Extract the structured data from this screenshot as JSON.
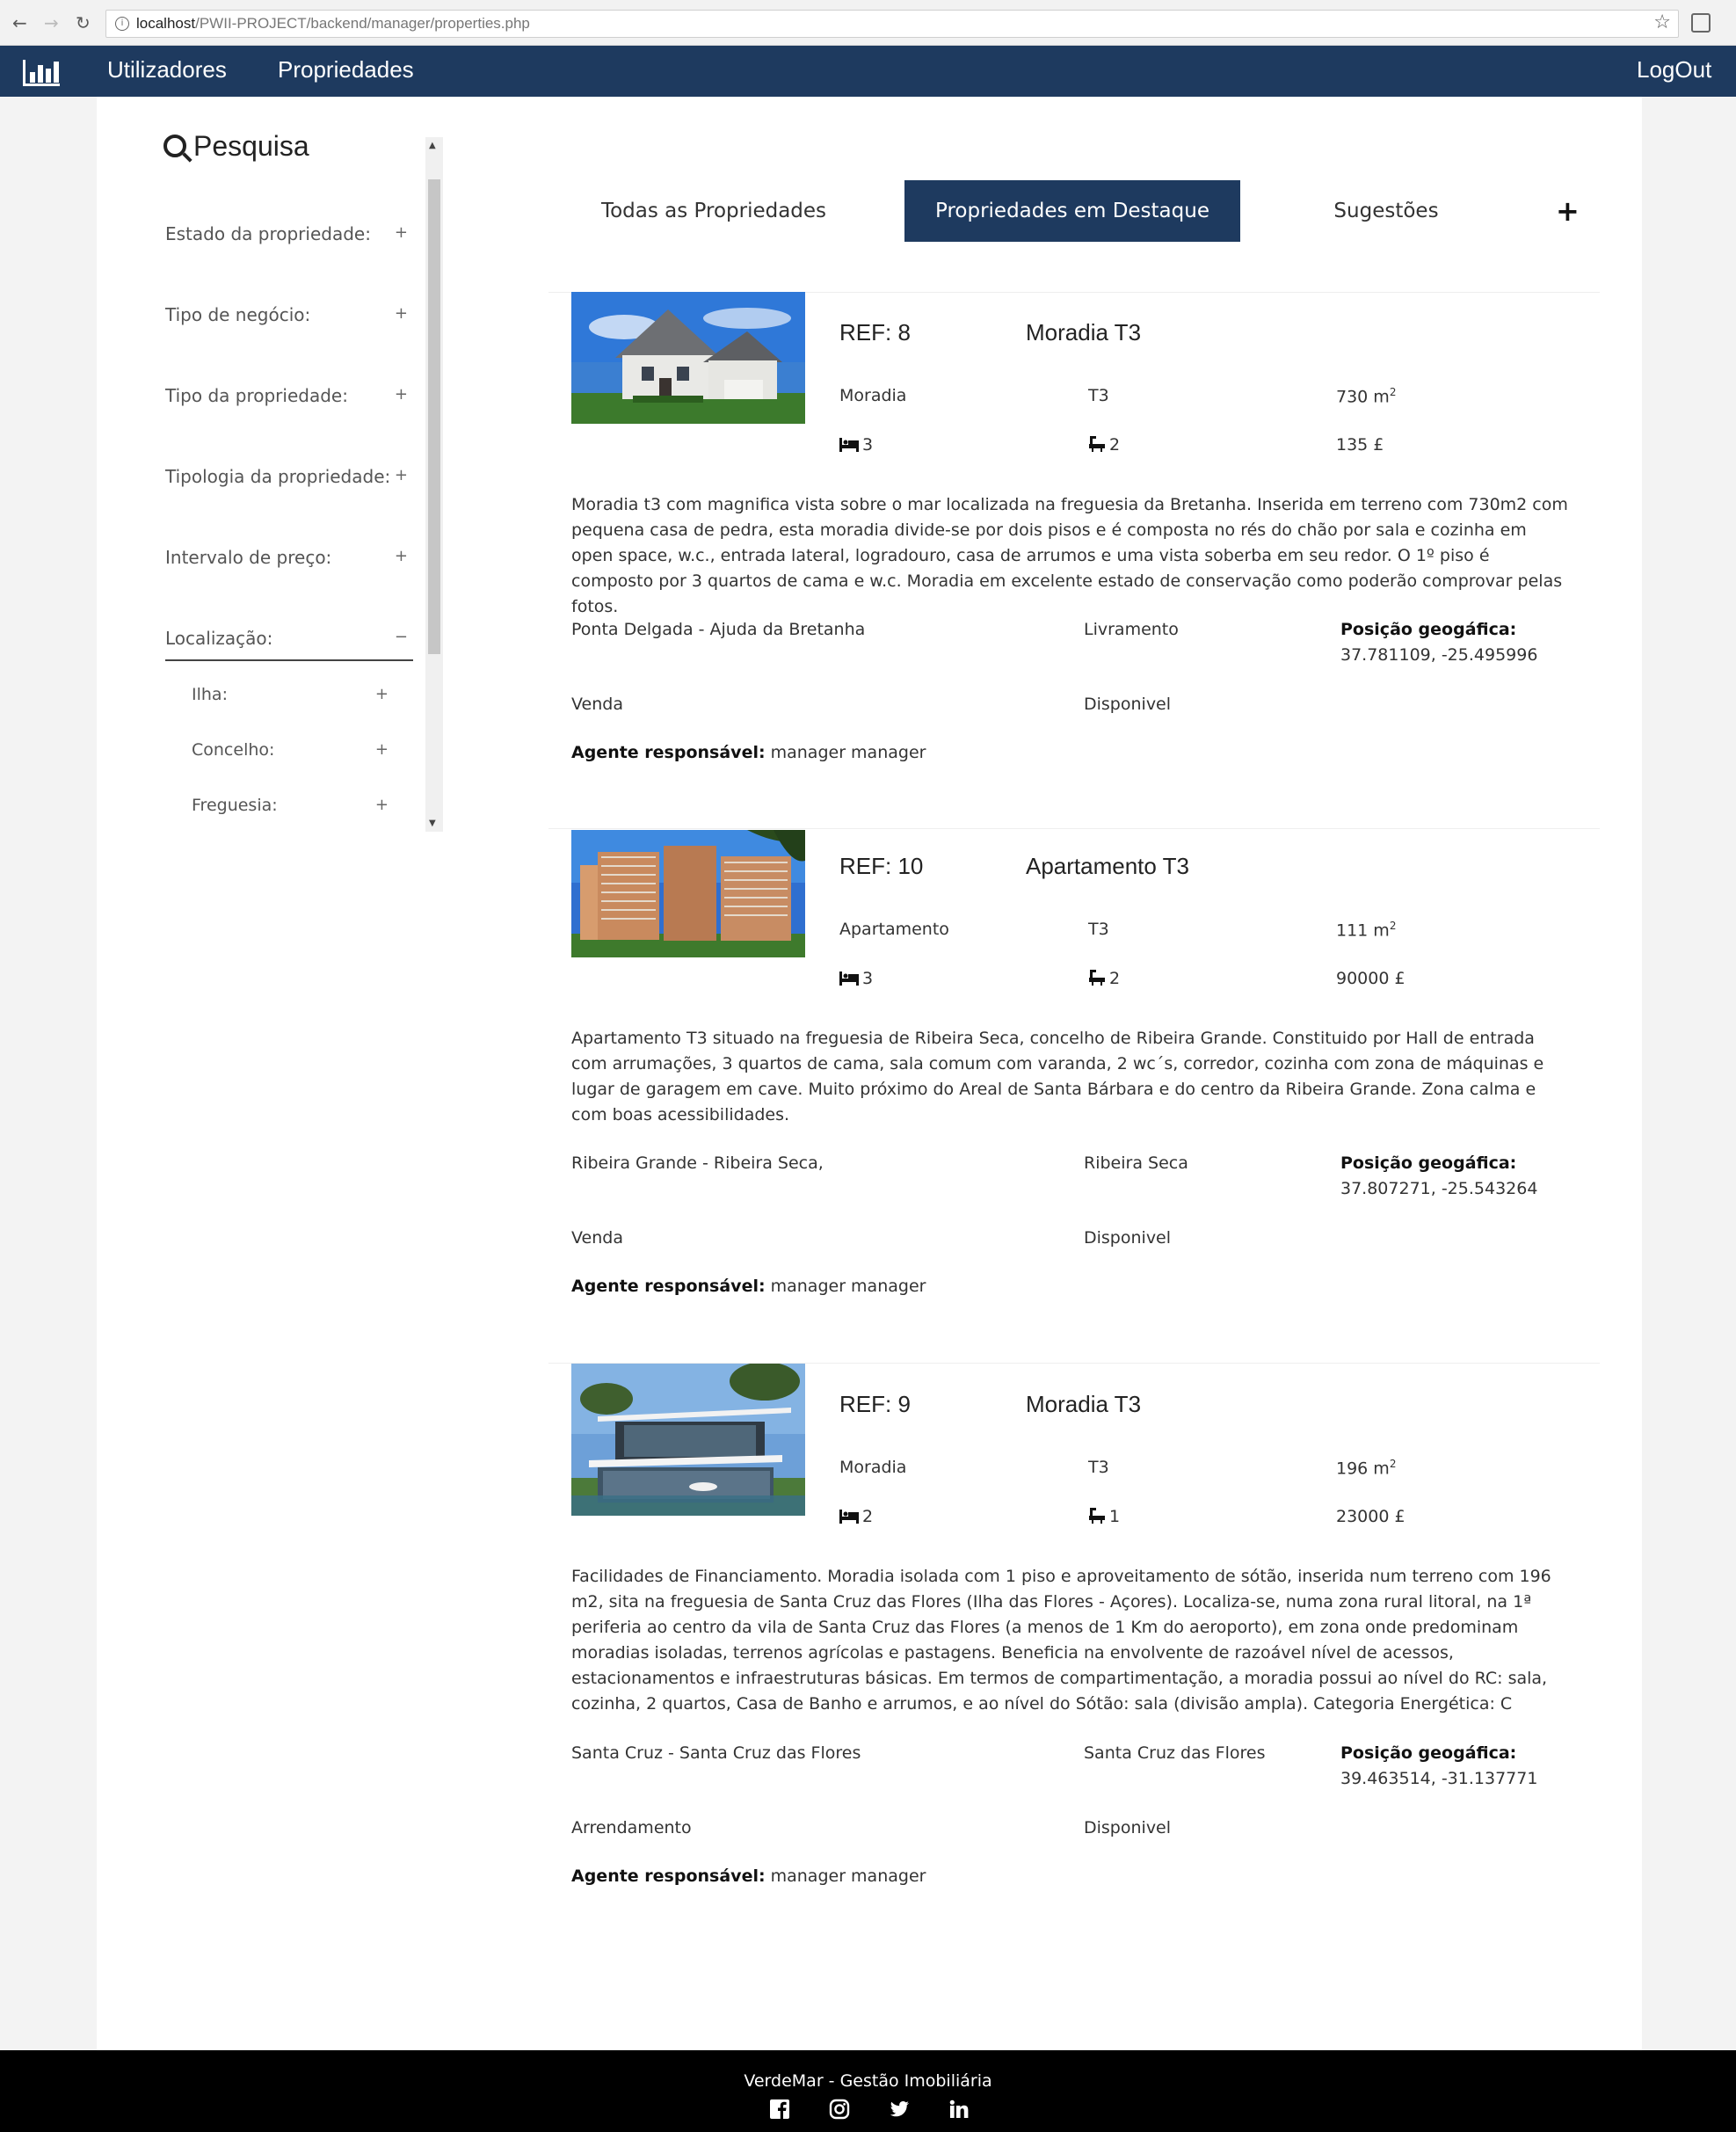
{
  "browser": {
    "url_host": "localhost",
    "url_path": "/PWII-PROJECT/backend/manager/properties.php"
  },
  "navbar": {
    "links": [
      "Utilizadores",
      "Propriedades"
    ],
    "logout": "LogOut"
  },
  "sidebar": {
    "title": "Pesquisa",
    "filters": [
      {
        "label": "Estado da propriedade:",
        "toggle": "+"
      },
      {
        "label": "Tipo de negócio:",
        "toggle": "+"
      },
      {
        "label": "Tipo da propriedade:",
        "toggle": "+"
      },
      {
        "label": "Tipologia da propriedade:",
        "toggle": "+"
      },
      {
        "label": "Intervalo de preço:",
        "toggle": "+"
      },
      {
        "label": "Localização:",
        "toggle": "−"
      }
    ],
    "sub_filters": [
      {
        "label": "Ilha:",
        "toggle": "+"
      },
      {
        "label": "Concelho:",
        "toggle": "+"
      },
      {
        "label": "Freguesia:",
        "toggle": "+"
      }
    ]
  },
  "tabs": {
    "all": "Todas as Propriedades",
    "featured": "Propriedades em Destaque",
    "suggestions": "Sugestões",
    "add": "+"
  },
  "properties": [
    {
      "ref": "REF: 8",
      "title": "Moradia T3",
      "type": "Moradia",
      "typology": "T3",
      "area": "730 m",
      "bedrooms": "3",
      "bathrooms": "2",
      "price": "135 £",
      "description": "Moradia t3 com magnifica vista sobre o mar localizada na freguesia da Bretanha. Inserida em terreno com 730m2 com pequena casa de pedra, esta moradia divide-se por dois pisos e é composta no rés do chão por sala e cozinha em open space, w.c., entrada lateral, logradouro, casa de arrumos e uma vista soberba em seu redor. O 1º piso é composto por 3 quartos de cama e w.c. Moradia em excelente estado de conservação como poderão comprovar pelas fotos.",
      "location": "Ponta Delgada - Ajuda da Bretanha",
      "place": "Livramento",
      "geo_label": "Posição geogáfica:",
      "geo": "37.781109, -25.495996",
      "business": "Venda",
      "status": "Disponivel",
      "agent_label": "Agente responsável:",
      "agent": "manager manager"
    },
    {
      "ref": "REF: 10",
      "title": "Apartamento T3",
      "type": "Apartamento",
      "typology": "T3",
      "area": "111 m",
      "bedrooms": "3",
      "bathrooms": "2",
      "price": "90000 £",
      "description": "Apartamento T3 situado na freguesia de Ribeira Seca, concelho de Ribeira Grande. Constituido por Hall de entrada com arrumações, 3 quartos de cama, sala comum com varanda, 2 wc´s, corredor, cozinha com zona de máquinas e lugar de garagem em cave. Muito próximo do Areal de Santa Bárbara e do centro da Ribeira Grande. Zona calma e com boas acessibilidades.",
      "location": "Ribeira Grande - Ribeira Seca,",
      "place": "Ribeira Seca",
      "geo_label": "Posição geogáfica:",
      "geo": "37.807271, -25.543264",
      "business": "Venda",
      "status": "Disponivel",
      "agent_label": "Agente responsável:",
      "agent": "manager manager"
    },
    {
      "ref": "REF: 9",
      "title": "Moradia T3",
      "type": "Moradia",
      "typology": "T3",
      "area": "196 m",
      "bedrooms": "2",
      "bathrooms": "1",
      "price": "23000 £",
      "description": "Facilidades de Financiamento. Moradia isolada com 1 piso e aproveitamento de sótão, inserida num terreno com 196 m2, sita na freguesia de Santa Cruz das Flores (Ilha das Flores - Açores). Localiza-se, numa zona rural litoral, na 1ª periferia ao centro da vila de Santa Cruz das Flores (a menos de 1 Km do aeroporto), em zona onde predominam moradias isoladas, terrenos agrícolas e pastagens. Beneficia na envolvente de razoável nível de acessos, estacionamentos e infraestruturas básicas. Em termos de compartimentação, a moradia possui ao nível do RC: sala, cozinha, 2 quartos, Casa de Banho e arrumos, e ao nível do Sótão: sala (divisão ampla). Categoria Energética: C",
      "location": "Santa Cruz - Santa Cruz das Flores",
      "place": "Santa Cruz das Flores",
      "geo_label": "Posição geogáfica:",
      "geo": "39.463514, -31.137771",
      "business": "Arrendamento",
      "status": "Disponivel",
      "agent_label": "Agente responsável:",
      "agent": "manager manager"
    }
  ],
  "area_unit_sup": "2",
  "footer": {
    "title": "VerdeMar - Gestão Imobiliária",
    "social_icons": [
      "facebook-icon",
      "instagram-icon",
      "twitter-icon",
      "linkedin-icon"
    ]
  },
  "colors": {
    "navbar": "#1e3a5f",
    "active_tab": "#1e3a5f",
    "footer": "#000000"
  }
}
